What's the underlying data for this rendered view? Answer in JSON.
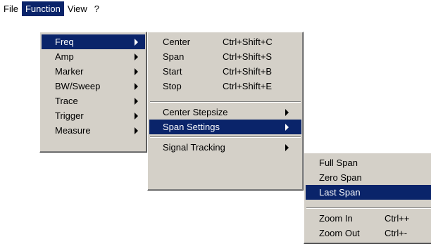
{
  "menubar": {
    "items": [
      {
        "label": "File"
      },
      {
        "label": "Function"
      },
      {
        "label": "View"
      },
      {
        "label": "?"
      }
    ]
  },
  "function_menu": {
    "items": [
      {
        "label": "Freq"
      },
      {
        "label": "Amp"
      },
      {
        "label": "Marker"
      },
      {
        "label": "BW/Sweep"
      },
      {
        "label": "Trace"
      },
      {
        "label": "Trigger"
      },
      {
        "label": "Measure"
      }
    ]
  },
  "freq_menu": {
    "items": [
      {
        "label": "Center",
        "shortcut": "Ctrl+Shift+C"
      },
      {
        "label": "Span",
        "shortcut": "Ctrl+Shift+S"
      },
      {
        "label": "Start",
        "shortcut": "Ctrl+Shift+B"
      },
      {
        "label": "Stop",
        "shortcut": "Ctrl+Shift+E"
      }
    ],
    "submenus": [
      {
        "label": "Center Stepsize"
      },
      {
        "label": "Span Settings"
      },
      {
        "label": "Signal Tracking"
      }
    ]
  },
  "span_menu": {
    "items": [
      {
        "label": "Full Span"
      },
      {
        "label": "Zero Span"
      },
      {
        "label": "Last Span"
      },
      {
        "label": "Zoom In",
        "shortcut": "Ctrl++"
      },
      {
        "label": "Zoom Out",
        "shortcut": "Ctrl+-"
      }
    ]
  }
}
